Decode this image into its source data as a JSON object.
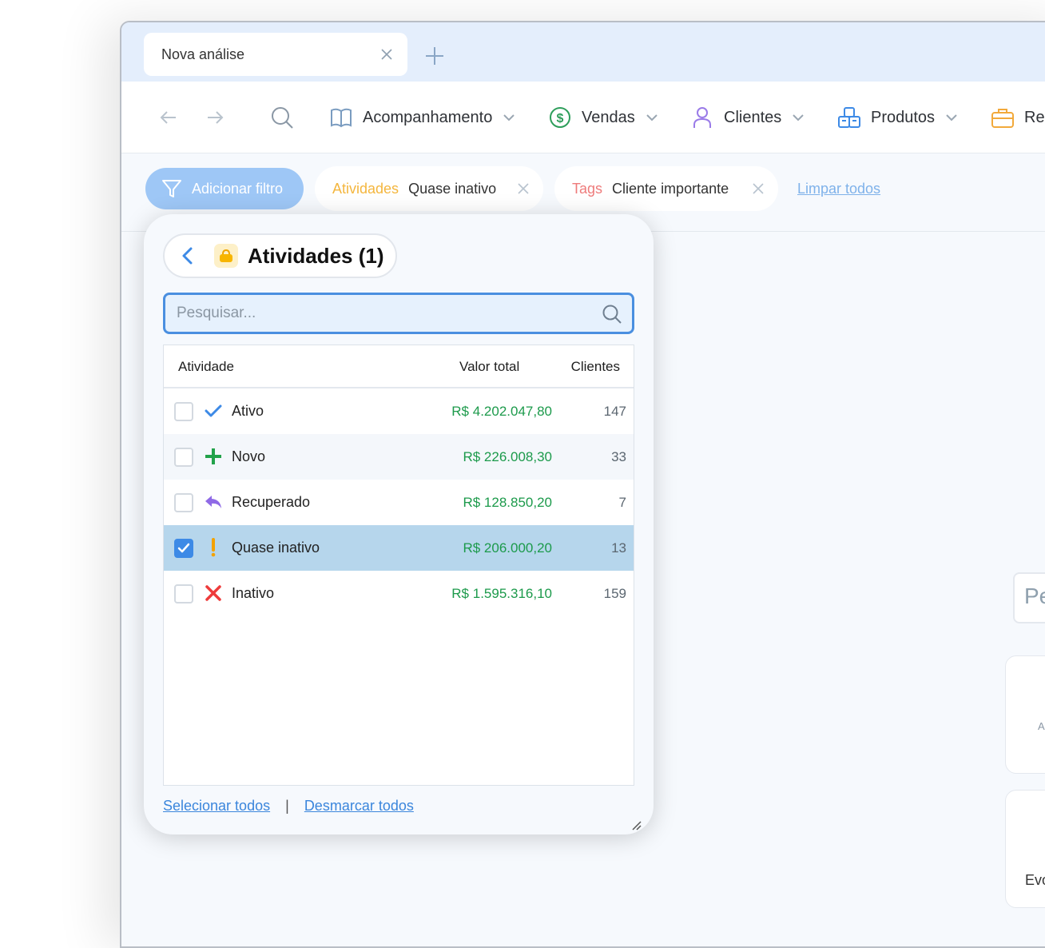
{
  "tab": {
    "title": "Nova análise"
  },
  "menus": [
    {
      "label": "Acompanhamento",
      "icon": "book-icon",
      "color": "#7a9cc0"
    },
    {
      "label": "Vendas",
      "icon": "dollar-icon",
      "color": "#2e9e5b"
    },
    {
      "label": "Clientes",
      "icon": "user-icon",
      "color": "#9a7be8"
    },
    {
      "label": "Produtos",
      "icon": "boxes-icon",
      "color": "#3d8ae6"
    },
    {
      "label": "Re",
      "icon": "briefcase-icon",
      "color": "#f2a93b"
    }
  ],
  "filters": {
    "add_label": "Adicionar filtro",
    "chips": [
      {
        "key": "Atividades",
        "value": "Quase inativo",
        "key_color": "#f4b63e"
      },
      {
        "key": "Tags",
        "value": "Cliente importante",
        "key_color": "#ee7b7b"
      }
    ],
    "clear_all": "Limpar todos"
  },
  "background": {
    "input_text": "Pe",
    "card1_text": "A",
    "card2_text": "Evo"
  },
  "popup": {
    "title": "Atividades (1)",
    "search_placeholder": "Pesquisar...",
    "columns": {
      "activity": "Atividade",
      "total": "Valor total",
      "clients": "Clientes"
    },
    "rows": [
      {
        "name": "Ativo",
        "icon": "check-icon",
        "value": "R$ 4.202.047,80",
        "count": "147",
        "checked": false
      },
      {
        "name": "Novo",
        "icon": "plus-icon",
        "value": "R$ 226.008,30",
        "count": "33",
        "checked": false
      },
      {
        "name": "Recuperado",
        "icon": "reply-arrow-icon",
        "value": "R$ 128.850,20",
        "count": "7",
        "checked": false
      },
      {
        "name": "Quase inativo",
        "icon": "exclamation-icon",
        "value": "R$ 206.000,20",
        "count": "13",
        "checked": true
      },
      {
        "name": "Inativo",
        "icon": "x-icon",
        "value": "R$ 1.595.316,10",
        "count": "159",
        "checked": false
      }
    ],
    "select_all": "Selecionar todos",
    "separator": "|",
    "deselect_all": "Desmarcar todos"
  }
}
